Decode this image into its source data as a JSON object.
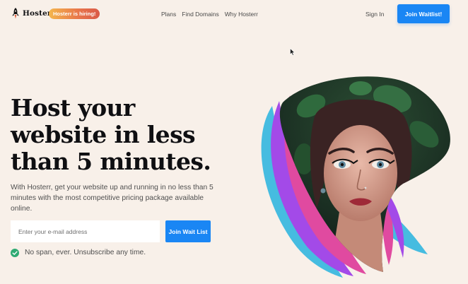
{
  "brand": {
    "name": "Hosterr",
    "hiring_badge": "Hosterr is hiring!"
  },
  "nav": {
    "items": [
      {
        "label": "Plans"
      },
      {
        "label": "Find Domains"
      },
      {
        "label": "Why Hosterr"
      }
    ],
    "signin_label": "Sign In",
    "cta_label": "Join Waitlist!"
  },
  "hero": {
    "title": "Host your website in less than 5 minutes.",
    "subtitle": "With Hosterr, get your website up and running in no less than 5 minutes with the most competitive pricing package available online.",
    "email_placeholder": "Enter your e-mail address",
    "submit_label": "Join Wait List",
    "note": "No span, ever. Unsubscribe any time."
  },
  "colors": {
    "background": "#f8f0e9",
    "accent": "#1a86f4",
    "check": "#2faa73",
    "ribbon_blue": "#46bce0",
    "ribbon_purple": "#a34ae8",
    "ribbon_pink": "#e04aa0"
  },
  "icons": {
    "logo": "rocket-icon",
    "note": "check-circle-icon",
    "cursor": "mouse-cursor-icon"
  }
}
